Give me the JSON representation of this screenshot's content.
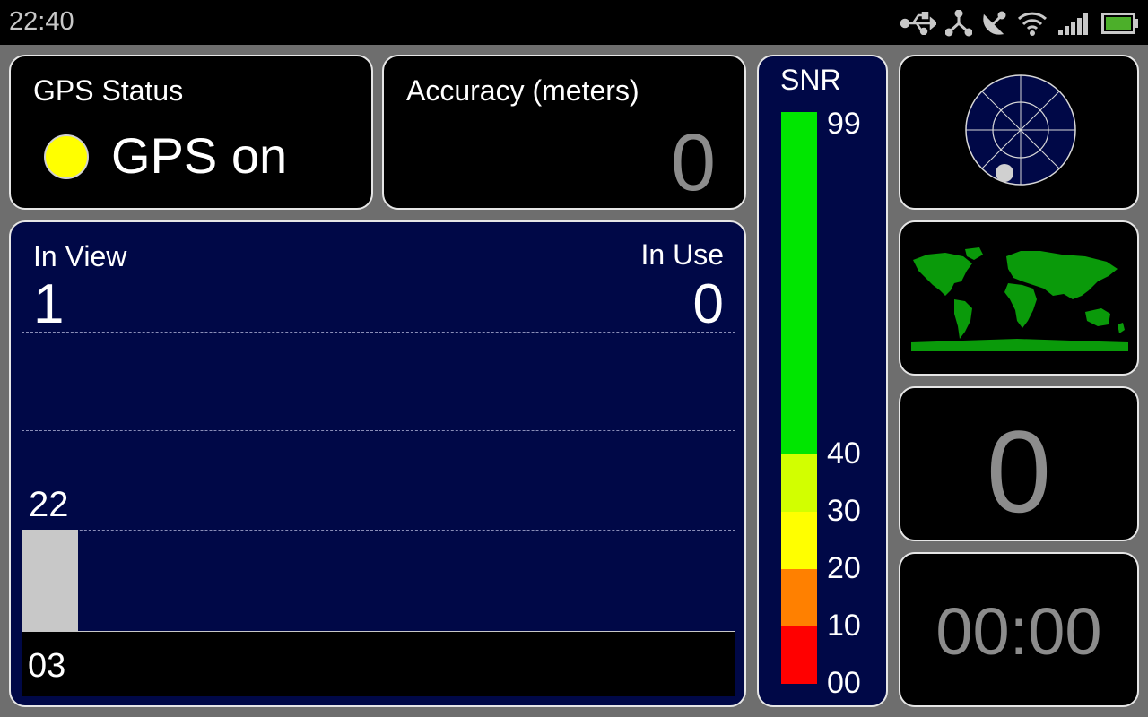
{
  "status_bar": {
    "time": "22:40",
    "icons": [
      "usb-icon",
      "debug-icon",
      "gps-satellite-icon",
      "wifi-icon",
      "signal-icon",
      "battery-icon"
    ],
    "battery_color": "#4caf2a"
  },
  "gps_status": {
    "title": "GPS Status",
    "indicator_color": "#ffff00",
    "state": "GPS on"
  },
  "accuracy": {
    "title": "Accuracy (meters)",
    "value": "0"
  },
  "satellites": {
    "in_view_label": "In View",
    "in_view_value": "1",
    "in_use_label": "In Use",
    "in_use_value": "0",
    "bar_color": "#c8c8c8",
    "bars": [
      {
        "prn": "03",
        "snr": 22
      }
    ]
  },
  "snr_scale": {
    "title": "SNR",
    "segments": [
      {
        "label": "99",
        "from": 40,
        "to": 99,
        "color": "#00e600"
      },
      {
        "label": "40",
        "from": 30,
        "to": 40,
        "color": "#d2ff00"
      },
      {
        "label": "30",
        "from": 20,
        "to": 30,
        "color": "#ffff00"
      },
      {
        "label": "20",
        "from": 10,
        "to": 20,
        "color": "#ff8000"
      },
      {
        "label": "10",
        "from": 0,
        "to": 10,
        "color": "#ff0000"
      }
    ],
    "ticks": [
      "99",
      "40",
      "30",
      "20",
      "10",
      "00"
    ]
  },
  "sidebar": {
    "radar_icon": "sky-radar-icon",
    "map_icon": "world-map-icon",
    "map_color": "#0a9a0a",
    "count_value": "0",
    "timer_value": "00:00"
  }
}
